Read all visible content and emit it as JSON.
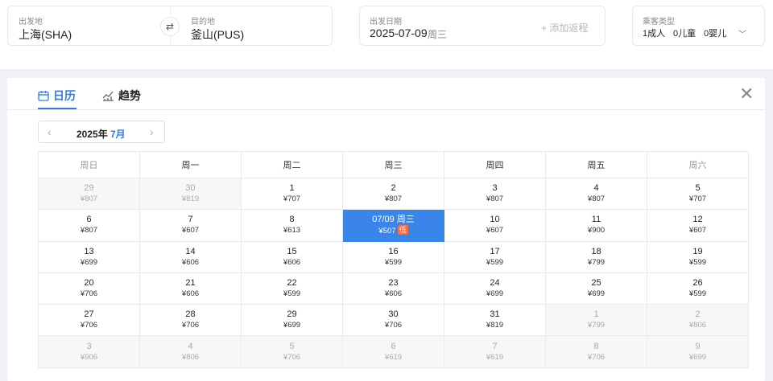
{
  "search": {
    "origin": {
      "label": "出发地",
      "value": "上海(SHA)"
    },
    "destination": {
      "label": "目的地",
      "value": "釜山(PUS)"
    },
    "swap_icon": "swap-arrows-icon",
    "depart": {
      "label": "出发日期",
      "date": "2025-07-09",
      "weekday": "周三"
    },
    "add_return": "+ 添加返程",
    "passenger": {
      "label": "乘客类型",
      "adult": "1成人",
      "child": "0儿童",
      "infant": "0婴儿"
    }
  },
  "tabs": [
    {
      "label": "日历",
      "icon": "calendar-icon",
      "active": true
    },
    {
      "label": "趋势",
      "icon": "trend-chart-icon",
      "active": false
    }
  ],
  "month_nav": {
    "year": "2025年",
    "month": "7月"
  },
  "weekdays": [
    "周日",
    "周一",
    "周二",
    "周三",
    "周四",
    "周五",
    "周六"
  ],
  "low_badge": "低",
  "weeks": [
    [
      {
        "d": "29",
        "p": "¥807",
        "o": true
      },
      {
        "d": "30",
        "p": "¥819",
        "o": true
      },
      {
        "d": "1",
        "p": "¥707"
      },
      {
        "d": "2",
        "p": "¥807"
      },
      {
        "d": "3",
        "p": "¥807"
      },
      {
        "d": "4",
        "p": "¥807"
      },
      {
        "d": "5",
        "p": "¥707"
      }
    ],
    [
      {
        "d": "6",
        "p": "¥807"
      },
      {
        "d": "7",
        "p": "¥607"
      },
      {
        "d": "8",
        "p": "¥613"
      },
      {
        "d": "07/09 周三",
        "p": "¥507",
        "sel": true,
        "low": true
      },
      {
        "d": "10",
        "p": "¥607"
      },
      {
        "d": "11",
        "p": "¥900"
      },
      {
        "d": "12",
        "p": "¥607"
      }
    ],
    [
      {
        "d": "13",
        "p": "¥699"
      },
      {
        "d": "14",
        "p": "¥606"
      },
      {
        "d": "15",
        "p": "¥606"
      },
      {
        "d": "16",
        "p": "¥599"
      },
      {
        "d": "17",
        "p": "¥599"
      },
      {
        "d": "18",
        "p": "¥799"
      },
      {
        "d": "19",
        "p": "¥599"
      }
    ],
    [
      {
        "d": "20",
        "p": "¥706"
      },
      {
        "d": "21",
        "p": "¥606"
      },
      {
        "d": "22",
        "p": "¥599"
      },
      {
        "d": "23",
        "p": "¥606"
      },
      {
        "d": "24",
        "p": "¥699"
      },
      {
        "d": "25",
        "p": "¥699"
      },
      {
        "d": "26",
        "p": "¥599"
      }
    ],
    [
      {
        "d": "27",
        "p": "¥706"
      },
      {
        "d": "28",
        "p": "¥706"
      },
      {
        "d": "29",
        "p": "¥699"
      },
      {
        "d": "30",
        "p": "¥706"
      },
      {
        "d": "31",
        "p": "¥819"
      },
      {
        "d": "1",
        "p": "¥799",
        "o": true
      },
      {
        "d": "2",
        "p": "¥806",
        "o": true
      }
    ],
    [
      {
        "d": "3",
        "p": "¥906",
        "o": true
      },
      {
        "d": "4",
        "p": "¥806",
        "o": true
      },
      {
        "d": "5",
        "p": "¥706",
        "o": true
      },
      {
        "d": "6",
        "p": "¥619",
        "o": true
      },
      {
        "d": "7",
        "p": "¥619",
        "o": true
      },
      {
        "d": "8",
        "p": "¥706",
        "o": true
      },
      {
        "d": "9",
        "p": "¥699",
        "o": true
      }
    ]
  ]
}
